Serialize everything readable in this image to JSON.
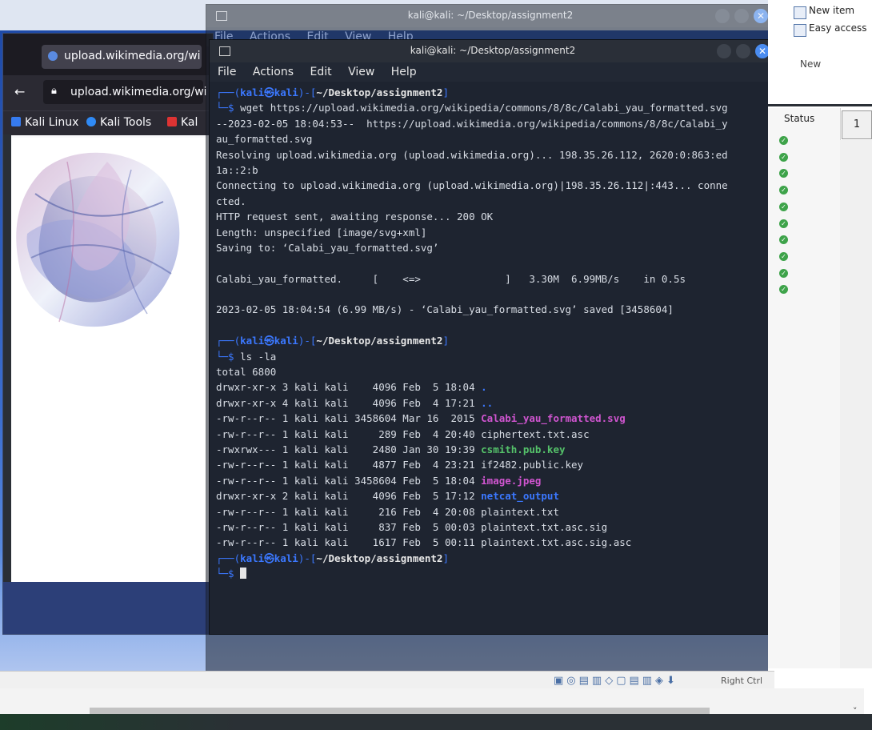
{
  "explorer": {
    "new_item": "New item",
    "easy_access": "Easy access",
    "new_caption": "New",
    "status_header": "Status",
    "page_number": "1",
    "status_rows": 10
  },
  "vm_statusbar": {
    "host_key": "Right Ctrl"
  },
  "firefox": {
    "tab_title": "upload.wikimedia.org/wi",
    "url": "upload.wikimedia.org/wi",
    "bookmarks": [
      {
        "label": "Kali Linux"
      },
      {
        "label": "Kali Tools"
      },
      {
        "label": "Kal"
      }
    ]
  },
  "term_back": {
    "title": "kali@kali: ~/Desktop/assignment2",
    "menu": [
      "File",
      "Actions",
      "Edit",
      "View",
      "Help"
    ]
  },
  "term_front": {
    "title": "kali@kali: ~/Desktop/assignment2",
    "menu": [
      "File",
      "Actions",
      "Edit",
      "View",
      "Help"
    ],
    "lines": [
      {
        "type": "prompt",
        "user": "kali",
        "host": "kali",
        "path": "~/Desktop/assignment2"
      },
      {
        "type": "cmd",
        "text": "wget https://upload.wikimedia.org/wikipedia/commons/8/8c/Calabi_yau_formatted.svg"
      },
      {
        "type": "text",
        "text": "--2023-02-05 18:04:53--  https://upload.wikimedia.org/wikipedia/commons/8/8c/Calabi_y"
      },
      {
        "type": "text",
        "text": "au_formatted.svg"
      },
      {
        "type": "text",
        "text": "Resolving upload.wikimedia.org (upload.wikimedia.org)... 198.35.26.112, 2620:0:863:ed"
      },
      {
        "type": "text",
        "text": "1a::2:b"
      },
      {
        "type": "text",
        "text": "Connecting to upload.wikimedia.org (upload.wikimedia.org)|198.35.26.112|:443... conne"
      },
      {
        "type": "text",
        "text": "cted."
      },
      {
        "type": "text",
        "text": "HTTP request sent, awaiting response... 200 OK"
      },
      {
        "type": "text",
        "text": "Length: unspecified [image/svg+xml]"
      },
      {
        "type": "text",
        "text": "Saving to: ‘Calabi_yau_formatted.svg’"
      },
      {
        "type": "text",
        "text": ""
      },
      {
        "type": "text",
        "text": "Calabi_yau_formatted.     [    <=>              ]   3.30M  6.99MB/s    in 0.5s"
      },
      {
        "type": "text",
        "text": ""
      },
      {
        "type": "text",
        "text": "2023-02-05 18:04:54 (6.99 MB/s) - ‘Calabi_yau_formatted.svg’ saved [3458604]"
      },
      {
        "type": "text",
        "text": ""
      },
      {
        "type": "prompt",
        "user": "kali",
        "host": "kali",
        "path": "~/Desktop/assignment2"
      },
      {
        "type": "cmd",
        "text": "ls -la"
      },
      {
        "type": "text",
        "text": "total 6800"
      },
      {
        "type": "ls",
        "perm": "drwxr-xr-x 3 kali kali    4096 Feb  5 18:04 ",
        "name": ".",
        "cls": "dir"
      },
      {
        "type": "ls",
        "perm": "drwxr-xr-x 4 kali kali    4096 Feb  4 17:21 ",
        "name": "..",
        "cls": "dir"
      },
      {
        "type": "ls",
        "perm": "-rw-r--r-- 1 kali kali 3458604 Mar 16  2015 ",
        "name": "Calabi_yau_formatted.svg",
        "cls": "img"
      },
      {
        "type": "ls",
        "perm": "-rw-r--r-- 1 kali kali     289 Feb  4 20:40 ",
        "name": "ciphertext.txt.asc",
        "cls": "plain"
      },
      {
        "type": "ls",
        "perm": "-rwxrwx--- 1 kali kali    2480 Jan 30 19:39 ",
        "name": "csmith.pub.key",
        "cls": "exec"
      },
      {
        "type": "ls",
        "perm": "-rw-r--r-- 1 kali kali    4877 Feb  4 23:21 ",
        "name": "if2482.public.key",
        "cls": "plain"
      },
      {
        "type": "ls",
        "perm": "-rw-r--r-- 1 kali kali 3458604 Feb  5 18:04 ",
        "name": "image.jpeg",
        "cls": "img"
      },
      {
        "type": "ls",
        "perm": "drwxr-xr-x 2 kali kali    4096 Feb  5 17:12 ",
        "name": "netcat_output",
        "cls": "dir"
      },
      {
        "type": "ls",
        "perm": "-rw-r--r-- 1 kali kali     216 Feb  4 20:08 ",
        "name": "plaintext.txt",
        "cls": "plain"
      },
      {
        "type": "ls",
        "perm": "-rw-r--r-- 1 kali kali     837 Feb  5 00:03 ",
        "name": "plaintext.txt.asc.sig",
        "cls": "plain"
      },
      {
        "type": "ls",
        "perm": "-rw-r--r-- 1 kali kali    1617 Feb  5 00:11 ",
        "name": "plaintext.txt.asc.sig.asc",
        "cls": "plain"
      },
      {
        "type": "prompt",
        "user": "kali",
        "host": "kali",
        "path": "~/Desktop/assignment2"
      },
      {
        "type": "cursor"
      }
    ]
  }
}
